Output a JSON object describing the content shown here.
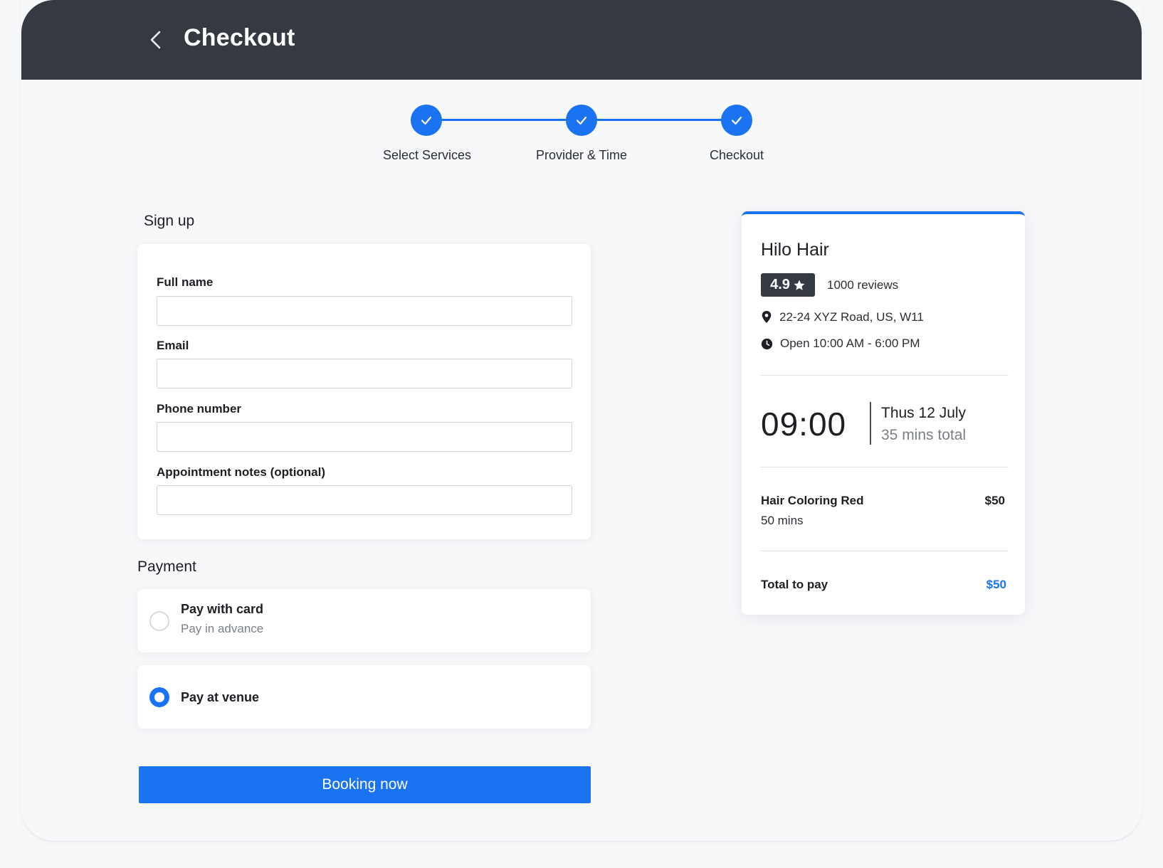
{
  "header": {
    "title": "Checkout",
    "back_icon": "chevron-left-icon"
  },
  "stepper": {
    "steps": [
      {
        "label": "Select Services",
        "status": "done"
      },
      {
        "label": "Provider & Time",
        "status": "done"
      },
      {
        "label": "Checkout",
        "status": "done"
      }
    ]
  },
  "signup": {
    "title": "Sign up",
    "fields": [
      {
        "label": "Full name",
        "value": "",
        "placeholder": ""
      },
      {
        "label": "Email",
        "value": "",
        "placeholder": ""
      },
      {
        "label": "Phone number",
        "value": "",
        "placeholder": ""
      },
      {
        "label": "Appointment notes (optional)",
        "value": "",
        "placeholder": ""
      }
    ]
  },
  "payment": {
    "title": "Payment",
    "options": [
      {
        "title": "Pay with card",
        "subtitle": "Pay in advance",
        "selected": false
      },
      {
        "title": "Pay at venue",
        "subtitle": "",
        "selected": true
      }
    ]
  },
  "book_button": "Booking now",
  "summary": {
    "business_name": "Hilo Hair",
    "rating": "4.9",
    "reviews": "1000 reviews",
    "address": "22-24 XYZ Road, US, W11",
    "hours": "Open 10:00 AM - 6:00 PM",
    "time": "09:00",
    "date": "Thus 12 July",
    "duration_total": "35 mins total",
    "service": {
      "name": "Hair Coloring Red",
      "duration": "50 mins",
      "price": "$50"
    },
    "total_label": "Total to pay",
    "total_price": "$50"
  },
  "colors": {
    "accent": "#1a73f0",
    "header": "#353a42",
    "background": "#f7f8fa"
  }
}
